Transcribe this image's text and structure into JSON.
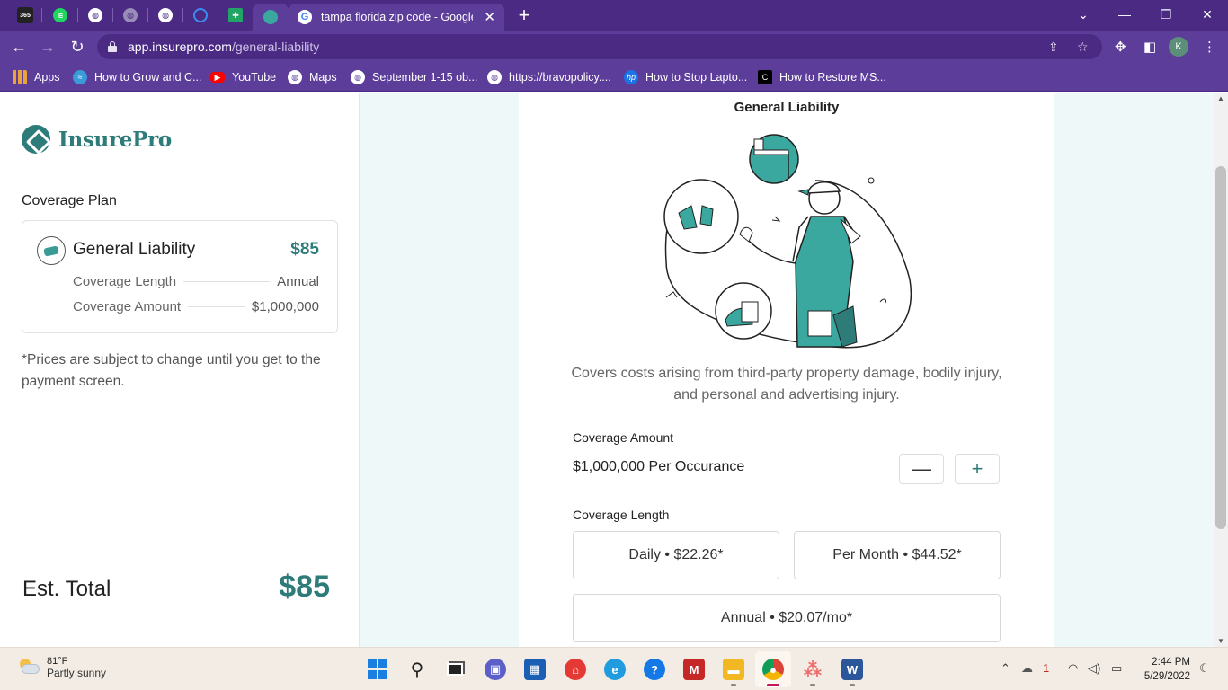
{
  "browser": {
    "tab_title": "tampa florida zip code - Google",
    "url_host": "app.insurepro.com",
    "url_path": "/general-liability",
    "profile_initial": "K",
    "pinned_tab_1": "365",
    "bookmarks": [
      {
        "label": "Apps",
        "icon": "apps-grid-icon",
        "color": "#e8a33d"
      },
      {
        "label": "How to Grow and C...",
        "icon": "site-icon",
        "color": "#3a9bd9"
      },
      {
        "label": "YouTube",
        "icon": "youtube-icon",
        "color": "#ff0000"
      },
      {
        "label": "Maps",
        "icon": "globe-icon",
        "color": "#ffffff"
      },
      {
        "label": "September 1-15 ob...",
        "icon": "globe-icon",
        "color": "#ffffff"
      },
      {
        "label": "https://bravopolicy....",
        "icon": "globe-icon",
        "color": "#ffffff"
      },
      {
        "label": "How to Stop Lapto...",
        "icon": "hp-icon",
        "color": "#1a73e8"
      },
      {
        "label": "How to Restore MS...",
        "icon": "c-icon",
        "color": "#000000"
      }
    ]
  },
  "sidebar": {
    "brand": "InsurePro",
    "coverage_plan_label": "Coverage Plan",
    "plan": {
      "name": "General Liability",
      "price": "$85",
      "rows": [
        {
          "label": "Coverage Length",
          "value": "Annual"
        },
        {
          "label": "Coverage Amount",
          "value": "$1,000,000"
        }
      ]
    },
    "disclaimer": "*Prices are subject to change until you get to the payment screen.",
    "total_label": "Est. Total",
    "total_value": "$85"
  },
  "main": {
    "title": "General Liability",
    "description": "Covers costs arising from third-party property damage, bodily injury, and personal and advertising injury.",
    "coverage_amount_label": "Coverage Amount",
    "coverage_amount_value": "$1,000,000 Per Occurance",
    "minus_label": "—",
    "plus_label": "+",
    "coverage_length_label": "Coverage Length",
    "options": {
      "daily": "Daily • $22.26*",
      "monthly": "Per Month • $44.52*",
      "annual": "Annual • $20.07/mo*"
    }
  },
  "taskbar": {
    "temperature": "81°F",
    "weather": "Partly sunny",
    "time": "2:44 PM",
    "date": "5/29/2022",
    "mail_badge": "1"
  },
  "colors": {
    "brand_teal": "#2e7c7a",
    "chrome_purple": "#5d3d9a",
    "chrome_dark": "#4a2a82",
    "main_bg": "#eef8f8"
  }
}
